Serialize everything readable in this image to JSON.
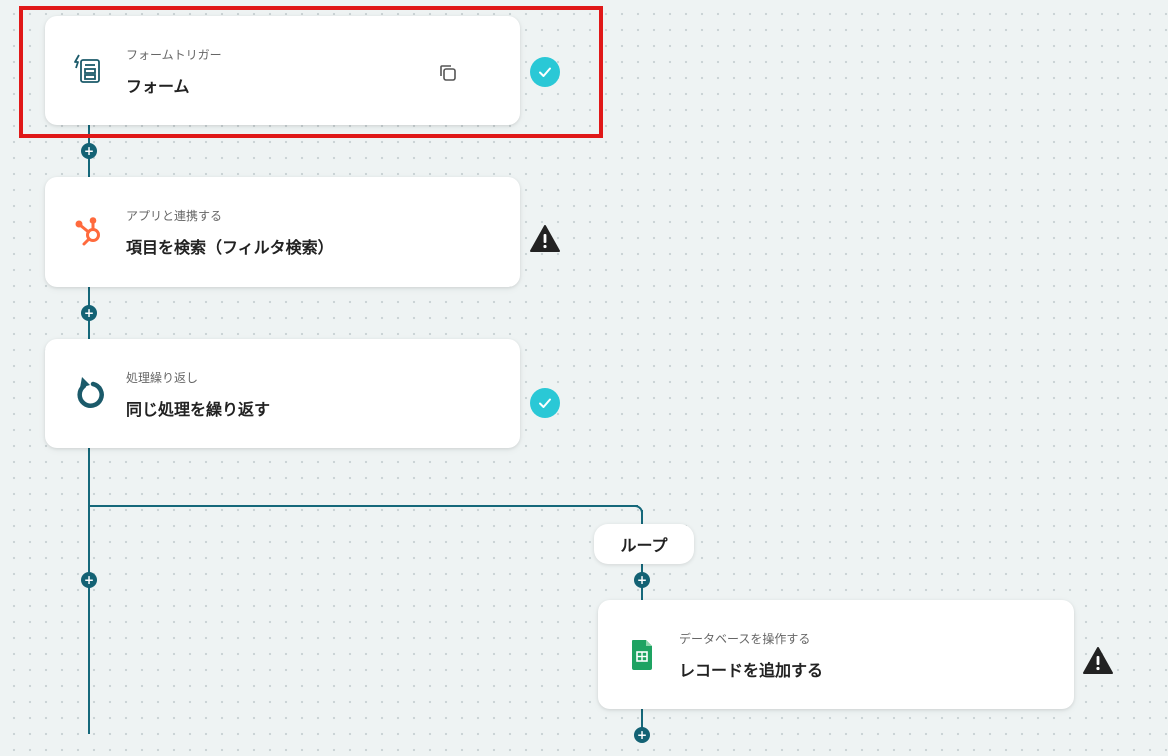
{
  "nodes": [
    {
      "subtitle": "フォームトリガー",
      "title": "フォーム",
      "icon": "form-icon",
      "status": "ok"
    },
    {
      "subtitle": "アプリと連携する",
      "title": "項目を検索（フィルタ検索）",
      "icon": "hubspot-icon",
      "status": "warning"
    },
    {
      "subtitle": "処理繰り返し",
      "title": "同じ処理を繰り返す",
      "icon": "loop-icon",
      "status": "ok"
    },
    {
      "subtitle": "データベースを操作する",
      "title": "レコードを追加する",
      "icon": "google-sheets-icon",
      "status": "warning"
    }
  ],
  "loop_label": "ループ",
  "plus_symbol": "+",
  "colors": {
    "connector": "#15687a",
    "ok": "#2ac8d6",
    "warning": "#222222",
    "highlight": "#e01818",
    "hubspot": "#ff6a3d",
    "sheets": "#1ea362"
  }
}
